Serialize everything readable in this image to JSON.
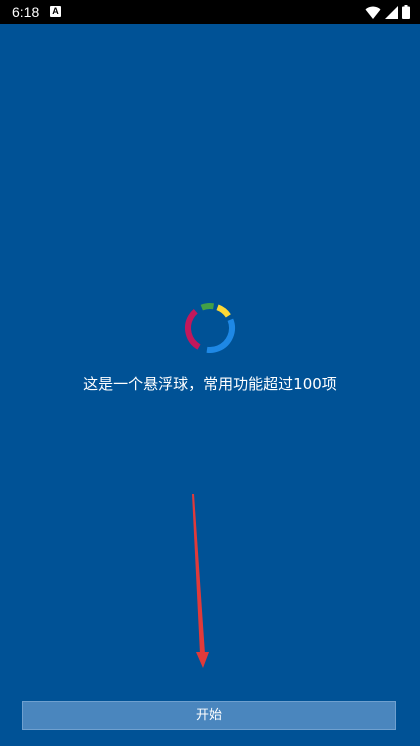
{
  "status_bar": {
    "time": "6:18",
    "notification_icon_letter": "A",
    "icons": [
      "wifi-icon",
      "signal-icon",
      "battery-icon"
    ]
  },
  "splash": {
    "logo_icon": "floating-ball-logo-icon",
    "tagline": "这是一个悬浮球，常用功能超过100项",
    "start_button_label": "开始"
  },
  "colors": {
    "background": "#005296",
    "button": "#4a86be",
    "arrow": "#e03a3a",
    "logo_segments": [
      "#c2185b",
      "#43a047",
      "#fdd835",
      "#1e88e5"
    ]
  }
}
